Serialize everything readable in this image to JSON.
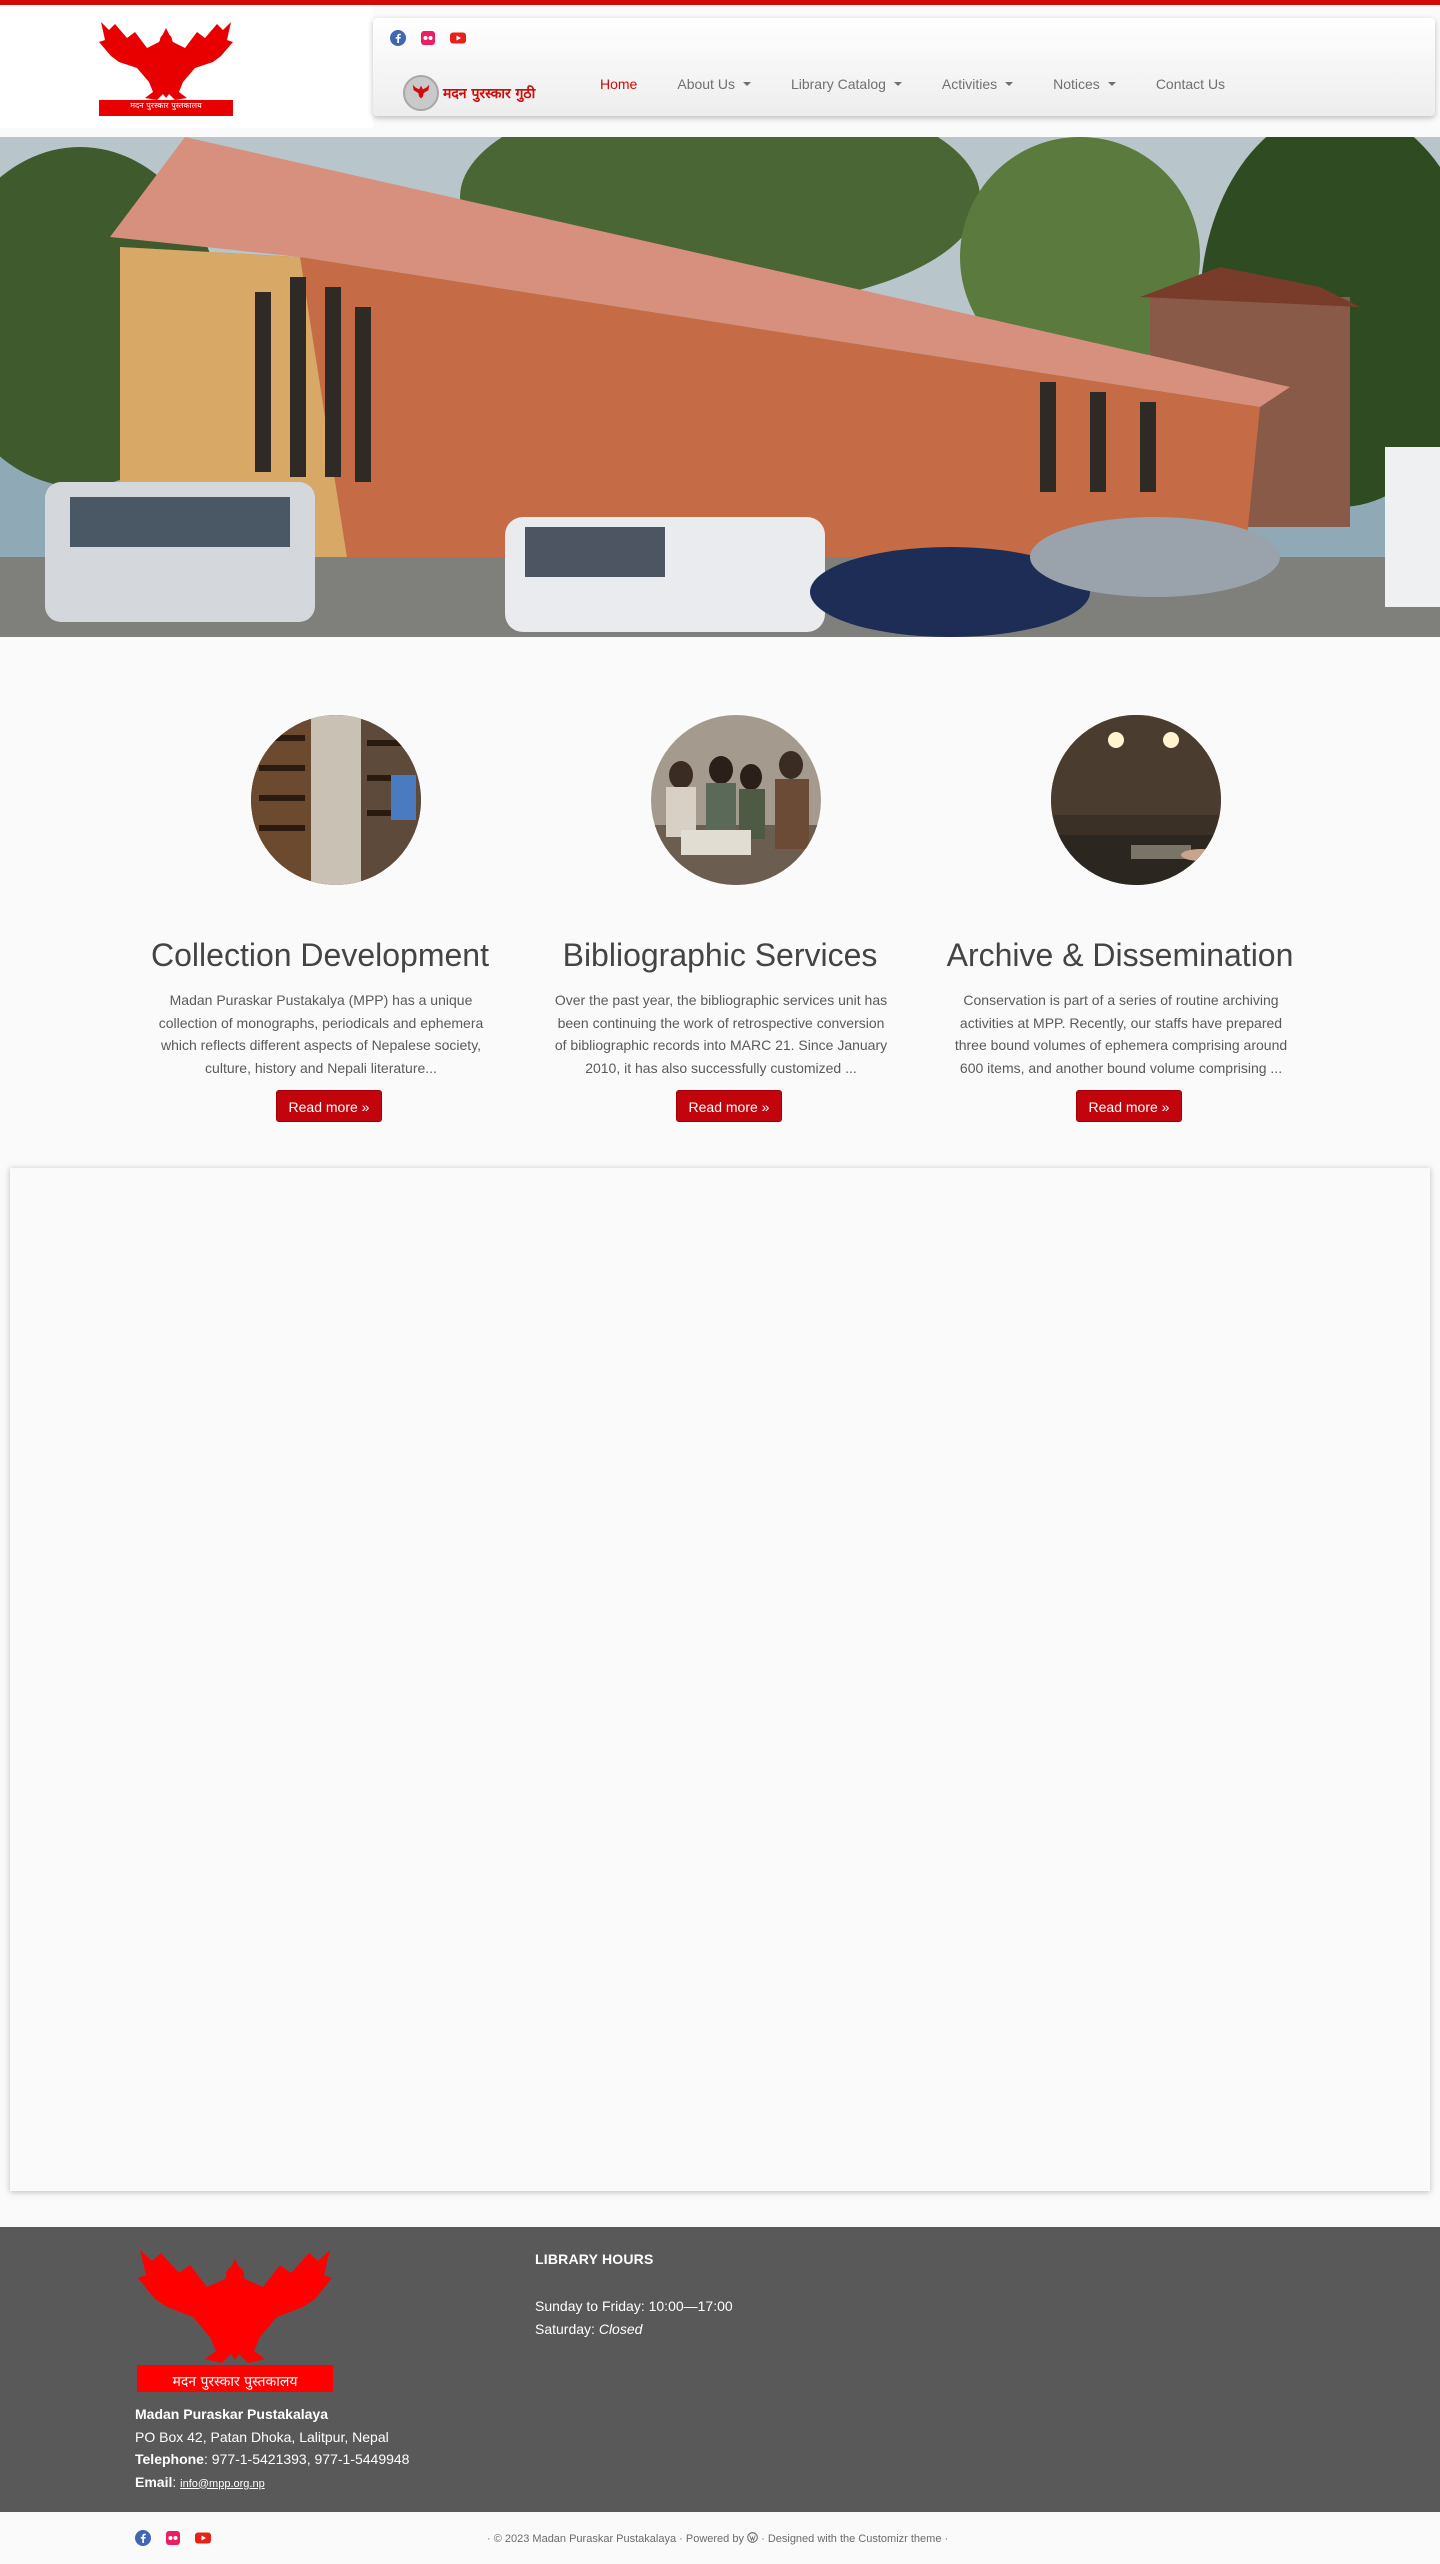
{
  "brand": {
    "logo_text": "मदन पुरस्कार पुस्तकालय",
    "nav_logo_text": "मदन पुरस्कार गुठी",
    "accent": "#d20a0a"
  },
  "social": [
    {
      "name": "facebook-icon",
      "color": "#4267b2"
    },
    {
      "name": "flickr-icon",
      "color": "#e91e63"
    },
    {
      "name": "youtube-icon",
      "color": "#e62117"
    }
  ],
  "nav": {
    "items": [
      {
        "label": "Home",
        "active": true,
        "dropdown": false
      },
      {
        "label": "About Us",
        "active": false,
        "dropdown": true
      },
      {
        "label": "Library Catalog",
        "active": false,
        "dropdown": true
      },
      {
        "label": "Activities",
        "active": false,
        "dropdown": true
      },
      {
        "label": "Notices",
        "active": false,
        "dropdown": true
      },
      {
        "label": "Contact Us",
        "active": false,
        "dropdown": false
      }
    ]
  },
  "features": [
    {
      "title": "Collection Development",
      "text": "Madan Puraskar Pustakalya (MPP) has a unique collection of monographs, periodicals and ephemera which reflects different aspects of Nepalese society, culture, history and Nepali literature...",
      "button": "Read more »"
    },
    {
      "title": "Bibliographic Services",
      "text": "Over the past year, the bibliographic services unit has been continuing the work of retrospective conversion of bibliographic records into MARC 21. Since January 2010, it has also successfully customized ...",
      "button": "Read more »"
    },
    {
      "title": "Archive & Dissemination",
      "text": "Conservation is part of a series of routine archiving activities at MPP. Recently, our staffs have prepared three bound volumes of ephemera comprising around 600 items, and another bound volume comprising ...",
      "button": "Read more »"
    }
  ],
  "footer": {
    "org_name": "Madan Puraskar Pustakalaya",
    "address": "PO Box 42, Patan Dhoka, Lalitpur, Nepal",
    "telephone_label": "Telephone",
    "telephone": ": 977-1-5421393, 977-1-5449948",
    "email_label": "Email",
    "email_sep": ": ",
    "email": "info@mpp.org.np",
    "hours_title": "LIBRARY HOURS",
    "hours_weekday": "Sunday to Friday: 10:00—17:00",
    "hours_sat_label": "Saturday: ",
    "hours_sat_value": "Closed"
  },
  "credits": {
    "left": "· © 2023 Madan Puraskar Pustakalaya · Powered by",
    "right": "· Designed with the Customizr theme ·"
  }
}
